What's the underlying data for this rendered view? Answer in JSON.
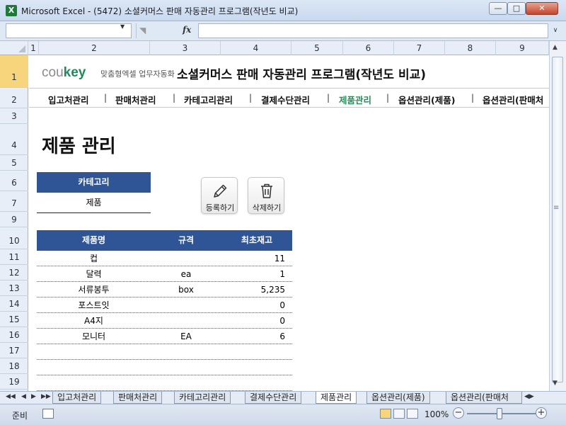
{
  "window": {
    "title": "Microsoft Excel - (5472) 소셜커머스 판매 자동관리 프로그램(작년도 비교)",
    "app_icon_glyph": "X"
  },
  "formula_bar": {
    "fx_label": "fx",
    "name_box_value": "",
    "formula_value": ""
  },
  "columns": [
    "1",
    "2",
    "3",
    "4",
    "5",
    "6",
    "7",
    "8",
    "9"
  ],
  "rows": [
    "1",
    "2",
    "3",
    "4",
    "5",
    "6",
    "7",
    "9",
    "10",
    "11",
    "12",
    "13",
    "14",
    "15",
    "16",
    "17",
    "18",
    "19"
  ],
  "header": {
    "logo_text": "cou",
    "logo_key": "key",
    "logo_sub": "맞춤형엑셀 업무자동화",
    "title": "소셜커머스 판매 자동관리 프로그램(작년도 비교)"
  },
  "nav": {
    "items": [
      {
        "label": "입고처관리"
      },
      {
        "label": "판매처관리"
      },
      {
        "label": "카테고리관리"
      },
      {
        "label": "결제수단관리"
      },
      {
        "label": "제품관리"
      },
      {
        "label": "옵션관리(제품)"
      },
      {
        "label": "옵션관리(판매처"
      }
    ],
    "separator": "|",
    "active_color": "#2a8a5a"
  },
  "page": {
    "heading": "제품 관리"
  },
  "category": {
    "label": "카테고리",
    "value": "제품"
  },
  "actions": {
    "register_label": "등록하기",
    "delete_label": "삭제하기"
  },
  "table": {
    "headers": {
      "name": "제품명",
      "spec": "규격",
      "stock": "최초재고"
    },
    "rows": [
      {
        "name": "컵",
        "spec": "",
        "stock": "11"
      },
      {
        "name": "달력",
        "spec": "ea",
        "stock": "1"
      },
      {
        "name": "서류봉투",
        "spec": "box",
        "stock": "5,235"
      },
      {
        "name": "포스트잇",
        "spec": "",
        "stock": "0"
      },
      {
        "name": "A4지",
        "spec": "",
        "stock": "0"
      },
      {
        "name": "모니터",
        "spec": "EA",
        "stock": "6"
      },
      {
        "name": "",
        "spec": "",
        "stock": ""
      },
      {
        "name": "",
        "spec": "",
        "stock": ""
      },
      {
        "name": "",
        "spec": "",
        "stock": ""
      }
    ],
    "header_color": "#2f5597"
  },
  "sheet_tabs": [
    {
      "label": "입고처관리"
    },
    {
      "label": "판매처관리"
    },
    {
      "label": "카테고리관리"
    },
    {
      "label": "결제수단관리"
    },
    {
      "label": "제품관리"
    },
    {
      "label": "옵션관리(제품)"
    },
    {
      "label": "옵션관리(판매처"
    }
  ],
  "status_bar": {
    "ready": "준비",
    "zoom": "100%",
    "zoom_minus": "−",
    "zoom_plus": "+"
  }
}
